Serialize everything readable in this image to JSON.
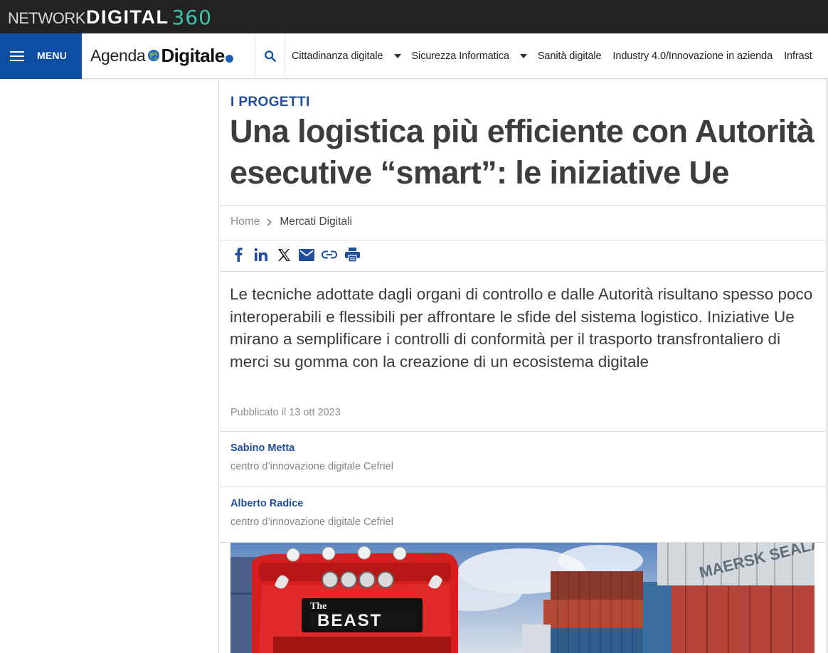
{
  "network_bar": {
    "brand_network": "NETWORK",
    "brand_digital": "DIGITAL",
    "brand_360": "360"
  },
  "header": {
    "menu_label": "MENU",
    "logo_agenda": "Agenda",
    "logo_digitale": "Digitale",
    "logo_eu_badge": "eu",
    "nav_items": [
      {
        "label": "Cittadinanza digitale",
        "has_dropdown": true
      },
      {
        "label": "Sicurezza Informatica",
        "has_dropdown": true
      },
      {
        "label": "Sanità digitale",
        "has_dropdown": false
      },
      {
        "label": "Industry 4.0/Innovazione in azienda",
        "has_dropdown": false
      },
      {
        "label": "Infrast",
        "has_dropdown": false
      }
    ]
  },
  "article": {
    "kicker": "I PROGETTI",
    "title": "Una logistica più efficiente con Autorità esecutive “smart”: le iniziative Ue",
    "breadcrumb": {
      "home": "Home",
      "current": "Mercati Digitali"
    },
    "share_icons": [
      "facebook-icon",
      "linkedin-icon",
      "x-icon",
      "email-icon",
      "link-icon",
      "print-icon"
    ],
    "lead": "Le tecniche adottate dagli organi di controllo e dalle Autorità risultano spesso poco interoperabili e flessibili per affrontare le sfide del sistema logistico. Iniziative Ue mirano a semplificare i controlli di conformità per il trasporto transfrontaliero di merci su gomma con la creazione di un ecosistema digitale",
    "published": "Pubblicato il 13 ott 2023",
    "authors": [
      {
        "name": "Sabino Metta",
        "affiliation": "centro d’innovazione digitale Cefriel"
      },
      {
        "name": "Alberto Radice",
        "affiliation": "centro d’innovazione digitale Cefriel"
      }
    ],
    "hero_image": {
      "truck_plate": "The BEAST",
      "container_text": "MAERSK SEALAND"
    }
  },
  "colors": {
    "network_bar_bg": "#222222",
    "brand_accent": "#3cc6b1",
    "menu_bg": "#0b4ea2",
    "link_blue": "#1f4e9c",
    "title_text": "#3d3d3d"
  }
}
